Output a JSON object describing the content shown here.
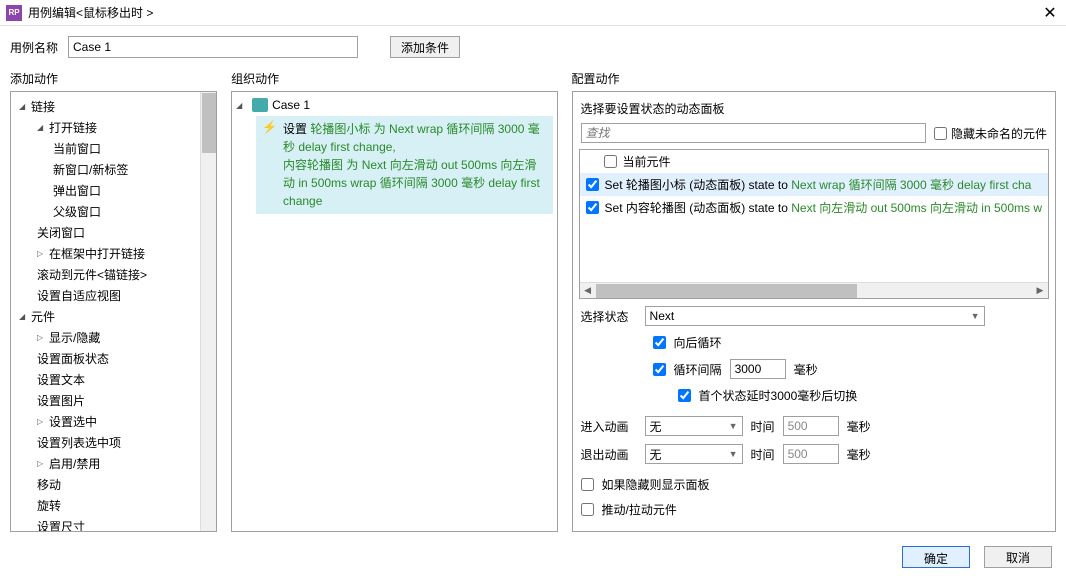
{
  "titlebar": {
    "title": "用例编辑<鼠标移出时 >"
  },
  "toprow": {
    "name_label": "用例名称",
    "case_name": "Case 1",
    "add_cond": "添加条件"
  },
  "col_headers": {
    "add_action": "添加动作",
    "org_action": "组织动作",
    "cfg_action": "配置动作"
  },
  "tree": {
    "links": "链接",
    "open_link": "打开链接",
    "cur_win": "当前窗口",
    "new_win": "新窗口/新标签",
    "popup": "弹出窗口",
    "parent": "父级窗口",
    "close_win": "关闭窗口",
    "open_in_frame": "在框架中打开链接",
    "scroll_to": "滚动到元件<锚链接>",
    "set_adaptive": "设置自适应视图",
    "widgets": "元件",
    "show_hide": "显示/隐藏",
    "set_panel": "设置面板状态",
    "set_text": "设置文本",
    "set_image": "设置图片",
    "set_selected": "设置选中",
    "set_list_sel": "设置列表选中项",
    "enable_disable": "启用/禁用",
    "move": "移动",
    "rotate": "旋转",
    "set_size": "设置尺寸"
  },
  "org": {
    "case_label": "Case 1",
    "set_label": "设置",
    "line1a": " 轮播图小标 为 Next wrap 循环间隔 3000 毫秒 delay first change,",
    "line2": "内容轮播图 为 Next 向左滑动 out 500ms 向左滑动 in 500ms wrap 循环间隔 3000 毫秒 delay first change"
  },
  "cfg": {
    "select_panel": "选择要设置状态的动态面板",
    "search_ph": "查找",
    "hide_unnamed": "隐藏未命名的元件",
    "cur_widget": "当前元件",
    "row1_a": "Set 轮播图小标 (动态面板) state to ",
    "row1_b": "Next wrap 循环间隔 3000 毫秒 delay first cha",
    "row2_a": "Set 内容轮播图 (动态面板) state to ",
    "row2_b": "Next 向左滑动 out 500ms 向左滑动 in 500ms w",
    "select_state": "选择状态",
    "state_val": "Next",
    "wrap_back": "向后循环",
    "loop_interval": "循环间隔",
    "interval_val": "3000",
    "ms": "毫秒",
    "first_delay": "首个状态延时3000毫秒后切换",
    "anim_in": "进入动画",
    "anim_out": "退出动画",
    "none": "无",
    "time": "时间",
    "time_val": "500",
    "show_if_hidden": "如果隐藏则显示面板",
    "push_pull": "推动/拉动元件"
  },
  "footer": {
    "ok": "确定",
    "cancel": "取消"
  }
}
